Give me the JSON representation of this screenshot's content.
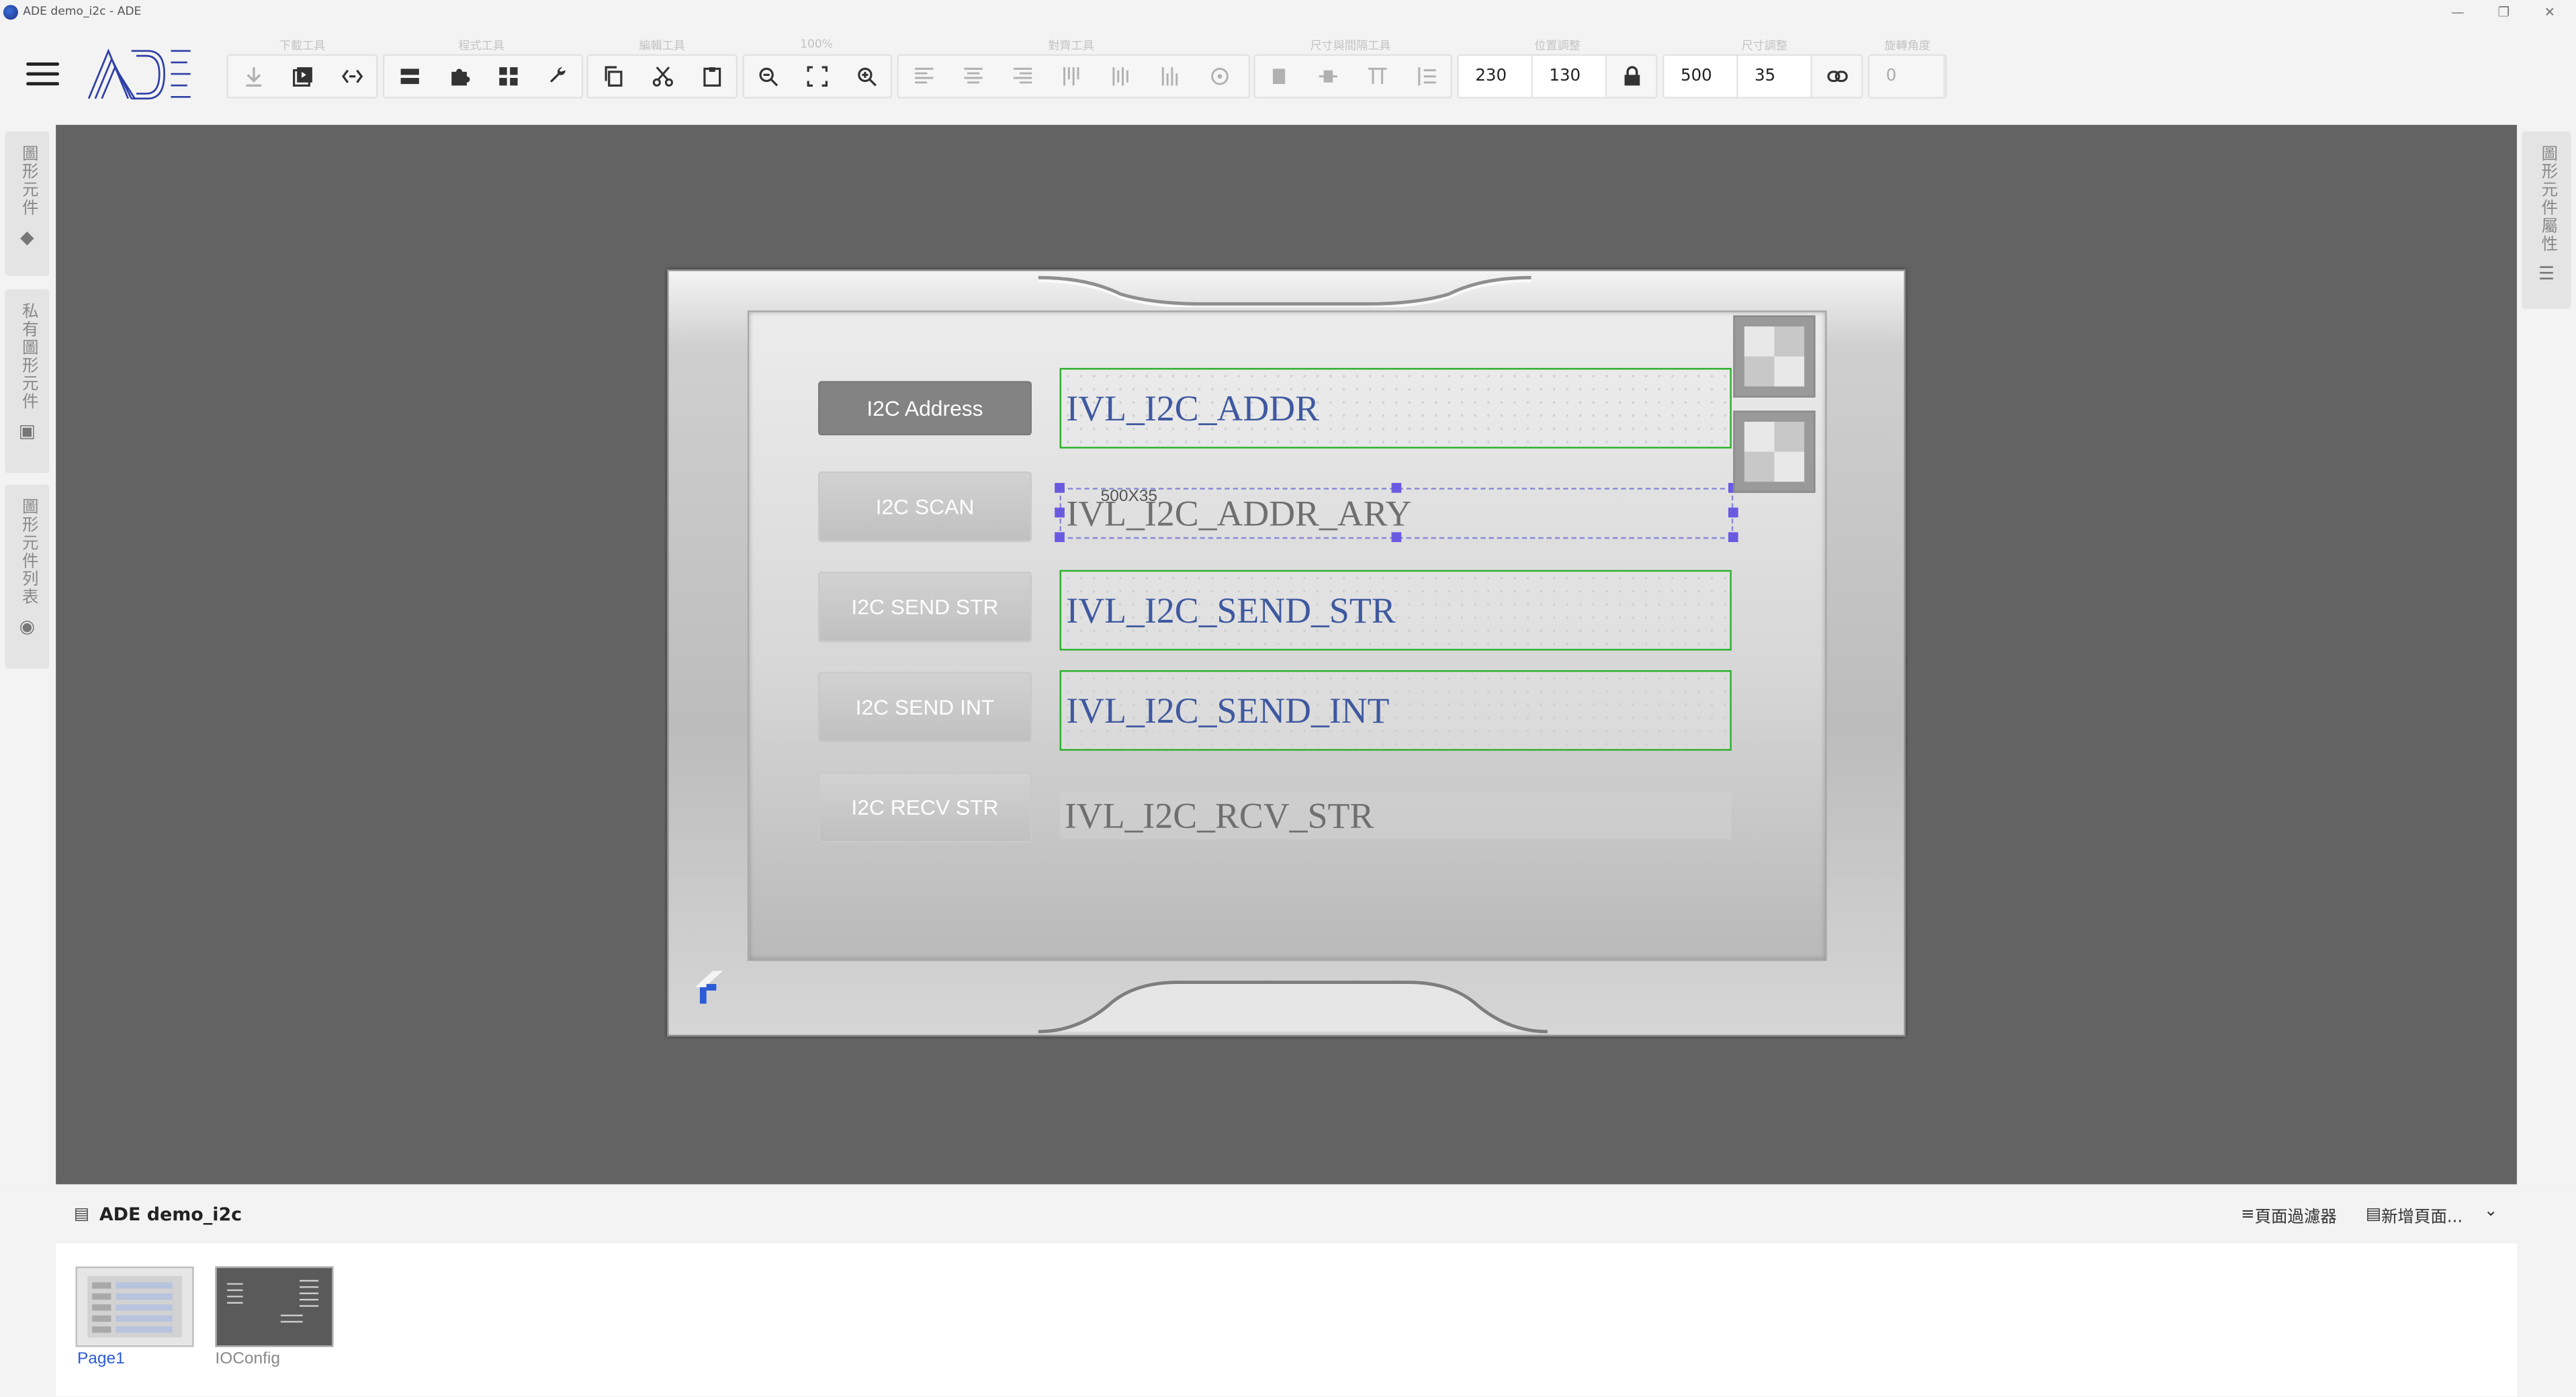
{
  "window": {
    "title": "ADE demo_i2c - ADE",
    "controls": {
      "minimize": "—",
      "restore": "❐",
      "close": "✕"
    }
  },
  "toolbar": {
    "groups": {
      "download": "下載工具",
      "program": "程式工具",
      "edit": "編輯工具",
      "zoom": "100%",
      "align": "對齊工具",
      "spacing": "尺寸與間隔工具",
      "position": "位置調整",
      "size": "尺寸調整",
      "rotation": "旋轉角度"
    },
    "position": {
      "x": "230",
      "y": "130"
    },
    "size": {
      "w": "500",
      "h": "35"
    },
    "rotation": "0"
  },
  "left_panels": {
    "p1": "圖形元件",
    "p2": "私有圖形元件",
    "p3": "圖形元件列表"
  },
  "right_panel": "圖形元件屬性",
  "hmi": {
    "buttons": [
      "I2C Address",
      "I2C SCAN",
      "I2C SEND STR",
      "I2C SEND INT",
      "I2C RECV STR"
    ],
    "fields": [
      "IVL_I2C_ADDR",
      "IVL_I2C_ADDR_ARY",
      "IVL_I2C_SEND_STR",
      "IVL_I2C_SEND_INT",
      "IVL_I2C_RCV_STR"
    ],
    "selection_size": "500X35"
  },
  "bottom": {
    "project": "ADE demo_i2c",
    "page_filter": "頁面過濾器",
    "add_page": "新增頁面...",
    "pages": [
      "Page1",
      "IOConfig"
    ]
  },
  "colors": {
    "accent": "#2b5bd7",
    "selection_green": "#2bb02b",
    "handle": "#6a5ae0"
  }
}
